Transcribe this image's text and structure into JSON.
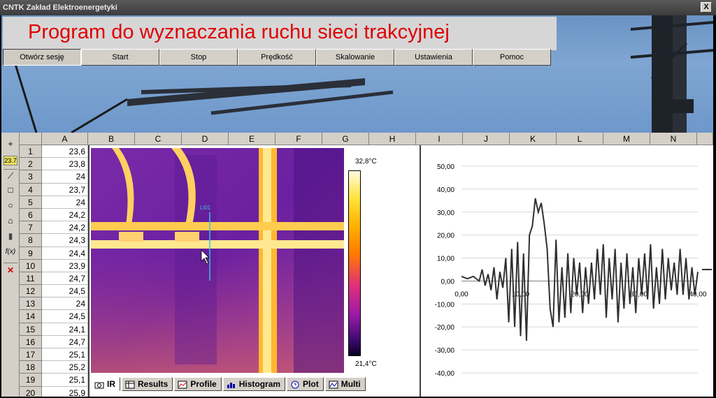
{
  "window": {
    "title": "CNTK Zakład Elektroenergetyki",
    "close_label": "X"
  },
  "banner": {
    "title": "Program do wyznaczania ruchu sieci trakcyjnej"
  },
  "menu": [
    {
      "label": "Otwórz sesję"
    },
    {
      "label": "Start"
    },
    {
      "label": "Stop"
    },
    {
      "label": "Prędkość"
    },
    {
      "label": "Skalowanie"
    },
    {
      "label": "Ustawienia"
    },
    {
      "label": "Pomoc"
    }
  ],
  "toolbar": [
    {
      "icon": "plus-icon",
      "glyph": "+"
    },
    {
      "icon": "temperature-icon",
      "glyph": "°"
    },
    {
      "icon": "line-icon",
      "glyph": "⟋"
    },
    {
      "icon": "rectangle-icon",
      "glyph": "□"
    },
    {
      "icon": "ellipse-icon",
      "glyph": "○"
    },
    {
      "icon": "polygon-icon",
      "glyph": "⌂"
    },
    {
      "icon": "probe-icon",
      "glyph": "▮"
    },
    {
      "icon": "function-icon",
      "glyph": "f(x)"
    },
    {
      "icon": "delete-icon",
      "glyph": "✕"
    }
  ],
  "spreadsheet": {
    "columns": [
      "A",
      "B",
      "C",
      "D",
      "E",
      "F",
      "G",
      "H",
      "I",
      "J",
      "K",
      "L",
      "M",
      "N"
    ],
    "rows": [
      "1",
      "2",
      "3",
      "4",
      "5",
      "6",
      "7",
      "8",
      "9",
      "10",
      "11",
      "12",
      "13",
      "14",
      "15",
      "16",
      "17",
      "18",
      "19",
      "20"
    ],
    "values": [
      "23,6",
      "23,8",
      "24",
      "23,7",
      "24",
      "24,2",
      "24,2",
      "24,3",
      "24,4",
      "23,9",
      "24,7",
      "24,5",
      "24",
      "24,5",
      "24,1",
      "24,7",
      "25,1",
      "25,2",
      "25,1",
      "25,9"
    ]
  },
  "ir_view": {
    "scale_max": "32,8°C",
    "scale_min": "21,4°C",
    "line_label": "Li01",
    "tabs": [
      {
        "label": "IR",
        "icon": "camera-icon"
      },
      {
        "label": "Results",
        "icon": "table-icon"
      },
      {
        "label": "Profile",
        "icon": "profile-icon"
      },
      {
        "label": "Histogram",
        "icon": "histogram-icon"
      },
      {
        "label": "Plot",
        "icon": "clock-icon"
      },
      {
        "label": "Multi",
        "icon": "multi-icon"
      }
    ]
  },
  "chart_data": {
    "type": "line",
    "title": "",
    "xlabel": "",
    "ylabel": "",
    "xlim": [
      0,
      40
    ],
    "ylim": [
      -40,
      50
    ],
    "y_ticks": [
      "50,00",
      "40,00",
      "30,00",
      "20,00",
      "10,00",
      "0,00",
      "-10,00",
      "-20,00",
      "-30,00",
      "-40,00"
    ],
    "x_ticks": [
      "0,00",
      "10,00",
      "20,00",
      "30,00",
      "40,00"
    ],
    "grid": true,
    "series": [
      {
        "x": [
          0,
          1,
          2,
          3,
          3.5,
          4,
          4.5,
          5,
          5.5,
          6,
          6.5,
          7,
          7.5,
          8,
          8.5,
          9,
          9.5,
          10,
          10.5,
          11,
          11.5,
          12,
          12.5,
          13,
          13.5,
          14,
          14.5,
          15,
          15.5,
          16,
          16.5,
          17,
          17.5,
          18,
          18.5,
          19,
          19.5,
          20,
          20.5,
          21,
          21.5,
          22,
          22.5,
          23,
          23.5,
          24,
          24.5,
          25,
          25.5,
          26,
          26.5,
          27,
          27.5,
          28,
          28.5,
          29,
          29.5,
          30,
          30.5,
          31,
          31.5,
          32,
          32.5,
          33,
          33.5,
          34,
          34.5,
          35,
          35.5,
          36,
          36.5,
          37,
          37.5,
          38,
          38.5,
          39,
          39.5,
          40
        ],
        "y": [
          2,
          1,
          2,
          0,
          5,
          -2,
          3,
          -4,
          6,
          -8,
          4,
          -3,
          10,
          -18,
          14,
          -20,
          17,
          -24,
          12,
          -26,
          20,
          24,
          36,
          30,
          34,
          25,
          14,
          -12,
          -20,
          18,
          -18,
          6,
          -16,
          12,
          -14,
          10,
          -6,
          8,
          -14,
          6,
          -10,
          8,
          -8,
          14,
          -6,
          16,
          -16,
          10,
          -8,
          14,
          -18,
          8,
          -12,
          12,
          -10,
          6,
          -14,
          10,
          -6,
          12,
          -8,
          16,
          -12,
          6,
          -10,
          14,
          -8,
          10,
          -4,
          8,
          -6,
          14,
          -6,
          10,
          -8,
          6,
          -6,
          4
        ]
      }
    ]
  }
}
